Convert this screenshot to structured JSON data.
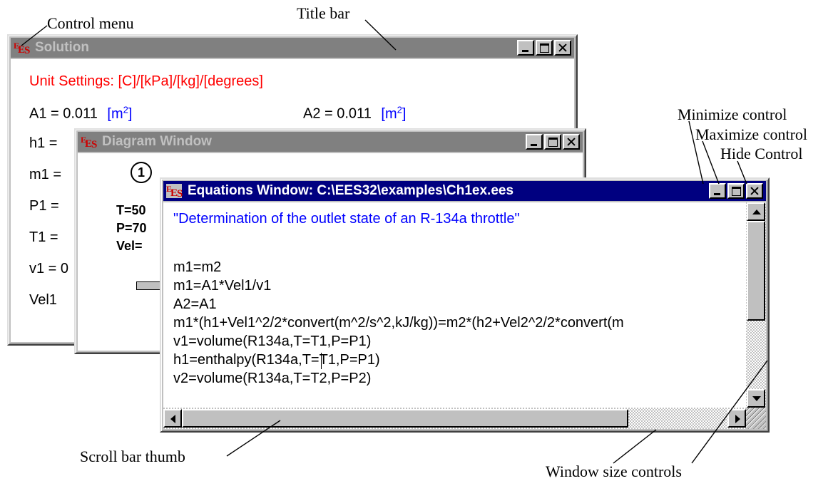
{
  "annotations": {
    "control_menu": "Control menu",
    "title_bar": "Title bar",
    "minimize_control": "Minimize control",
    "maximize_control": "Maximize control",
    "hide_control": "Hide Control",
    "scroll_bar_thumb": "Scroll bar thumb",
    "window_size_controls": "Window size controls"
  },
  "solution_window": {
    "title": "Solution",
    "unit_settings": "Unit Settings: [C]/[kPa]/[kg]/[degrees]",
    "rows": {
      "a1": "A1  = 0.011",
      "a1_unit": "[m",
      "a1_unit_sup": "2",
      "a1_unit_close": "]",
      "a2": "A2  = 0.011",
      "a2_unit": "[m",
      "a2_unit_sup": "2",
      "a2_unit_close": "]",
      "h1": "h1  =",
      "m1": "m1 =",
      "p1": "P1  =",
      "t1": "T1  =",
      "v1": "v1 = 0",
      "vel1": "Vel1"
    }
  },
  "diagram_window": {
    "title": "Diagram Window",
    "node_label": "1",
    "t_line": "T=50",
    "p_line": "P=70",
    "vel_line": "Vel="
  },
  "equations_window": {
    "title": "Equations Window: C:\\EES32\\examples\\Ch1ex.ees",
    "comment": "\"Determination of the outlet state of an R-134a throttle\"",
    "lines": [
      "m1=m2",
      "m1=A1*Vel1/v1",
      "A2=A1",
      "m1*(h1+Vel1^2/2*convert(m^2/s^2,kJ/kg))=m2*(h2+Vel2^2/2*convert(m",
      "v1=volume(R134a,T=T1,P=P1)",
      "h1=enthalpy(R134a,T=T1,P=P1)",
      "v2=volume(R134a,T=T2,P=P2)"
    ]
  },
  "colors": {
    "active_title": "#000080",
    "inactive_title": "#808080",
    "unit_red": "#ff0000",
    "unit_blue": "#0000ff",
    "comment_blue": "#0000ff"
  }
}
